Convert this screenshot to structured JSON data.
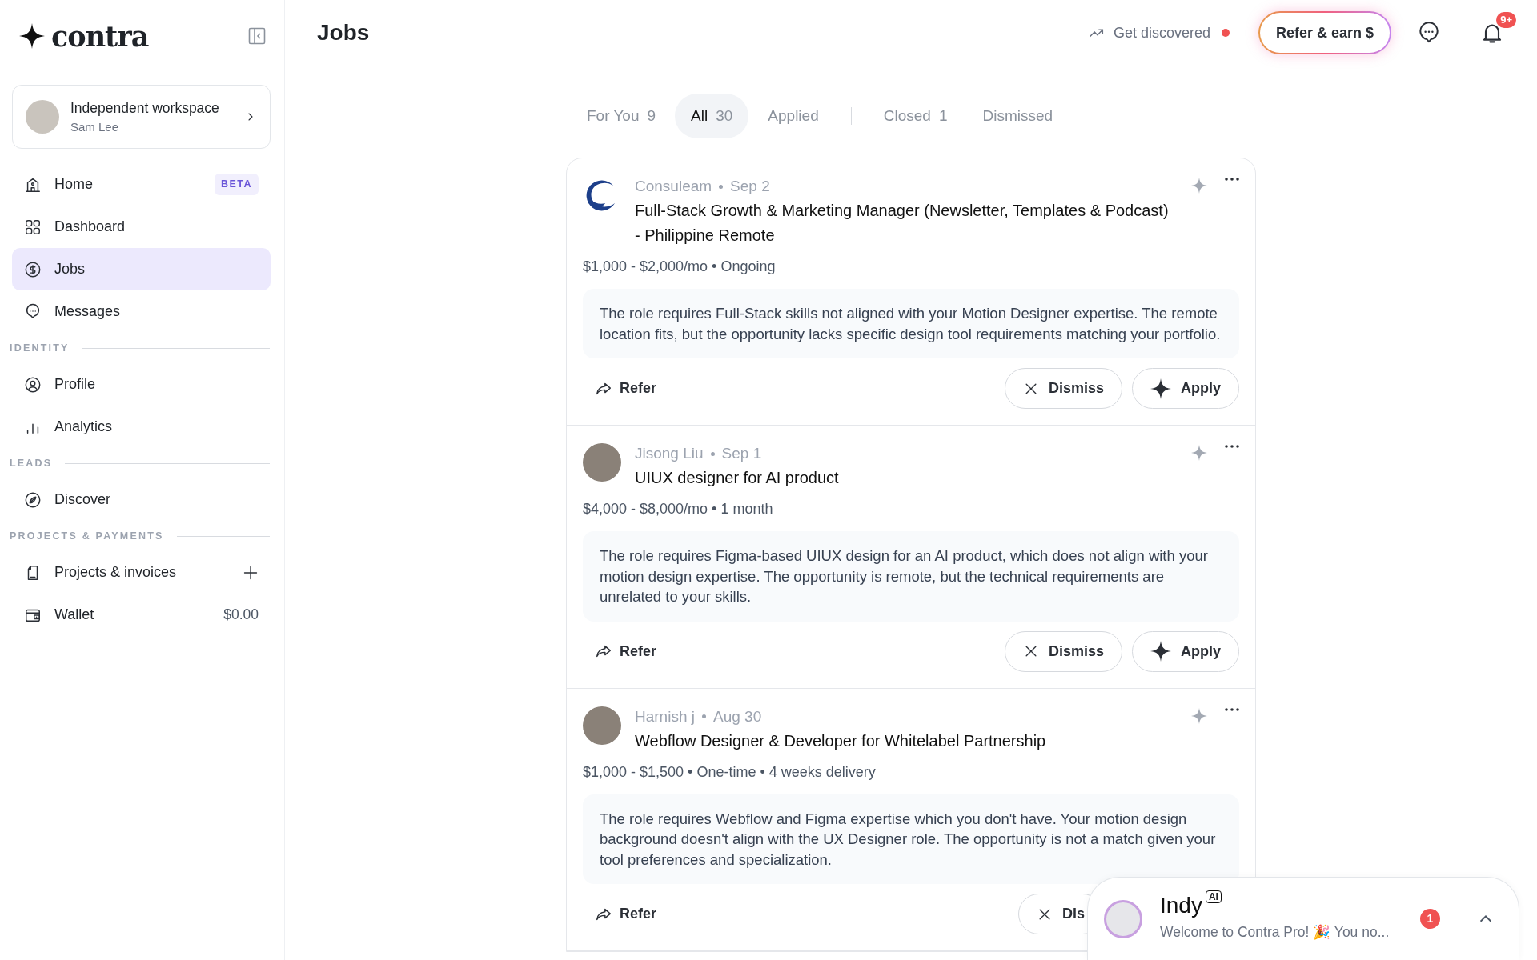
{
  "sidebar": {
    "logo": "contra",
    "workspace": {
      "title": "Independent workspace",
      "user": "Sam Lee"
    },
    "sections": [
      {
        "items": [
          {
            "label": "Home",
            "badge": "BETA",
            "selected": false
          },
          {
            "label": "Dashboard",
            "selected": false
          },
          {
            "label": "Jobs",
            "selected": true
          },
          {
            "label": "Messages",
            "selected": false
          }
        ]
      },
      {
        "heading": "IDENTITY",
        "items": [
          {
            "label": "Profile",
            "selected": false
          },
          {
            "label": "Analytics",
            "selected": false
          }
        ]
      },
      {
        "heading": "LEADS",
        "items": [
          {
            "label": "Discover",
            "selected": false
          }
        ]
      },
      {
        "heading": "PROJECTS & PAYMENTS",
        "items": [
          {
            "label": "Projects & invoices",
            "add": true,
            "selected": false
          },
          {
            "label": "Wallet",
            "value": "$0.00",
            "selected": false
          }
        ]
      }
    ]
  },
  "header": {
    "title": "Jobs",
    "get_discovered": {
      "label": "Get discovered",
      "notified": true
    },
    "refer_button": "Refer & earn $",
    "notifications_badge": "9+"
  },
  "tabs": [
    {
      "label": "For You",
      "count": "9",
      "selected": false
    },
    {
      "label": "All",
      "count": "30",
      "selected": true
    },
    {
      "label": "Applied",
      "selected": false,
      "divider_after": true
    },
    {
      "label": "Closed",
      "count": "1",
      "selected": false
    },
    {
      "label": "Dismissed",
      "selected": false
    }
  ],
  "jobs": [
    {
      "poster": "Consuleam",
      "date": "Sep 2",
      "kind": "company",
      "title": "Full-Stack Growth & Marketing Manager (Newsletter, Templates & Podcast) - Philippine Remote",
      "terms": "$1,000 - $2,000/mo • Ongoing",
      "reason": "The role requires Full-Stack skills not aligned with your Motion Designer expertise. The remote location fits, but the opportunity lacks specific design tool requirements matching your portfolio.",
      "refer": "Refer",
      "buttons": [
        "Dismiss",
        "Apply"
      ]
    },
    {
      "poster": "Jisong Liu",
      "date": "Sep 1",
      "kind": "person",
      "title": "UIUX designer for AI product",
      "terms": "$4,000 - $8,000/mo • 1 month",
      "reason": "The role requires Figma-based UIUX design for an AI product, which does not align with your motion design expertise. The opportunity is remote, but the technical requirements are unrelated to your skills.",
      "refer": "Refer",
      "buttons": [
        "Dismiss",
        "Apply"
      ]
    },
    {
      "poster": "Harnish j",
      "date": "Aug 30",
      "kind": "person",
      "title": "Webflow Designer & Developer for Whitelabel Partnership",
      "terms": "$1,000 - $1,500 • One-time • 4 weeks delivery",
      "reason": "The role requires Webflow and Figma expertise which you don't have. Your motion design background doesn't align with the UX Designer role. The opportunity is not a match given your tool preferences and specialization.",
      "refer": "Refer",
      "buttons": [
        "Dis"
      ]
    }
  ],
  "chat": {
    "name": "Indy",
    "tag": "AI",
    "message": "Welcome to Contra Pro! 🎉 You no...",
    "unread": "1"
  }
}
